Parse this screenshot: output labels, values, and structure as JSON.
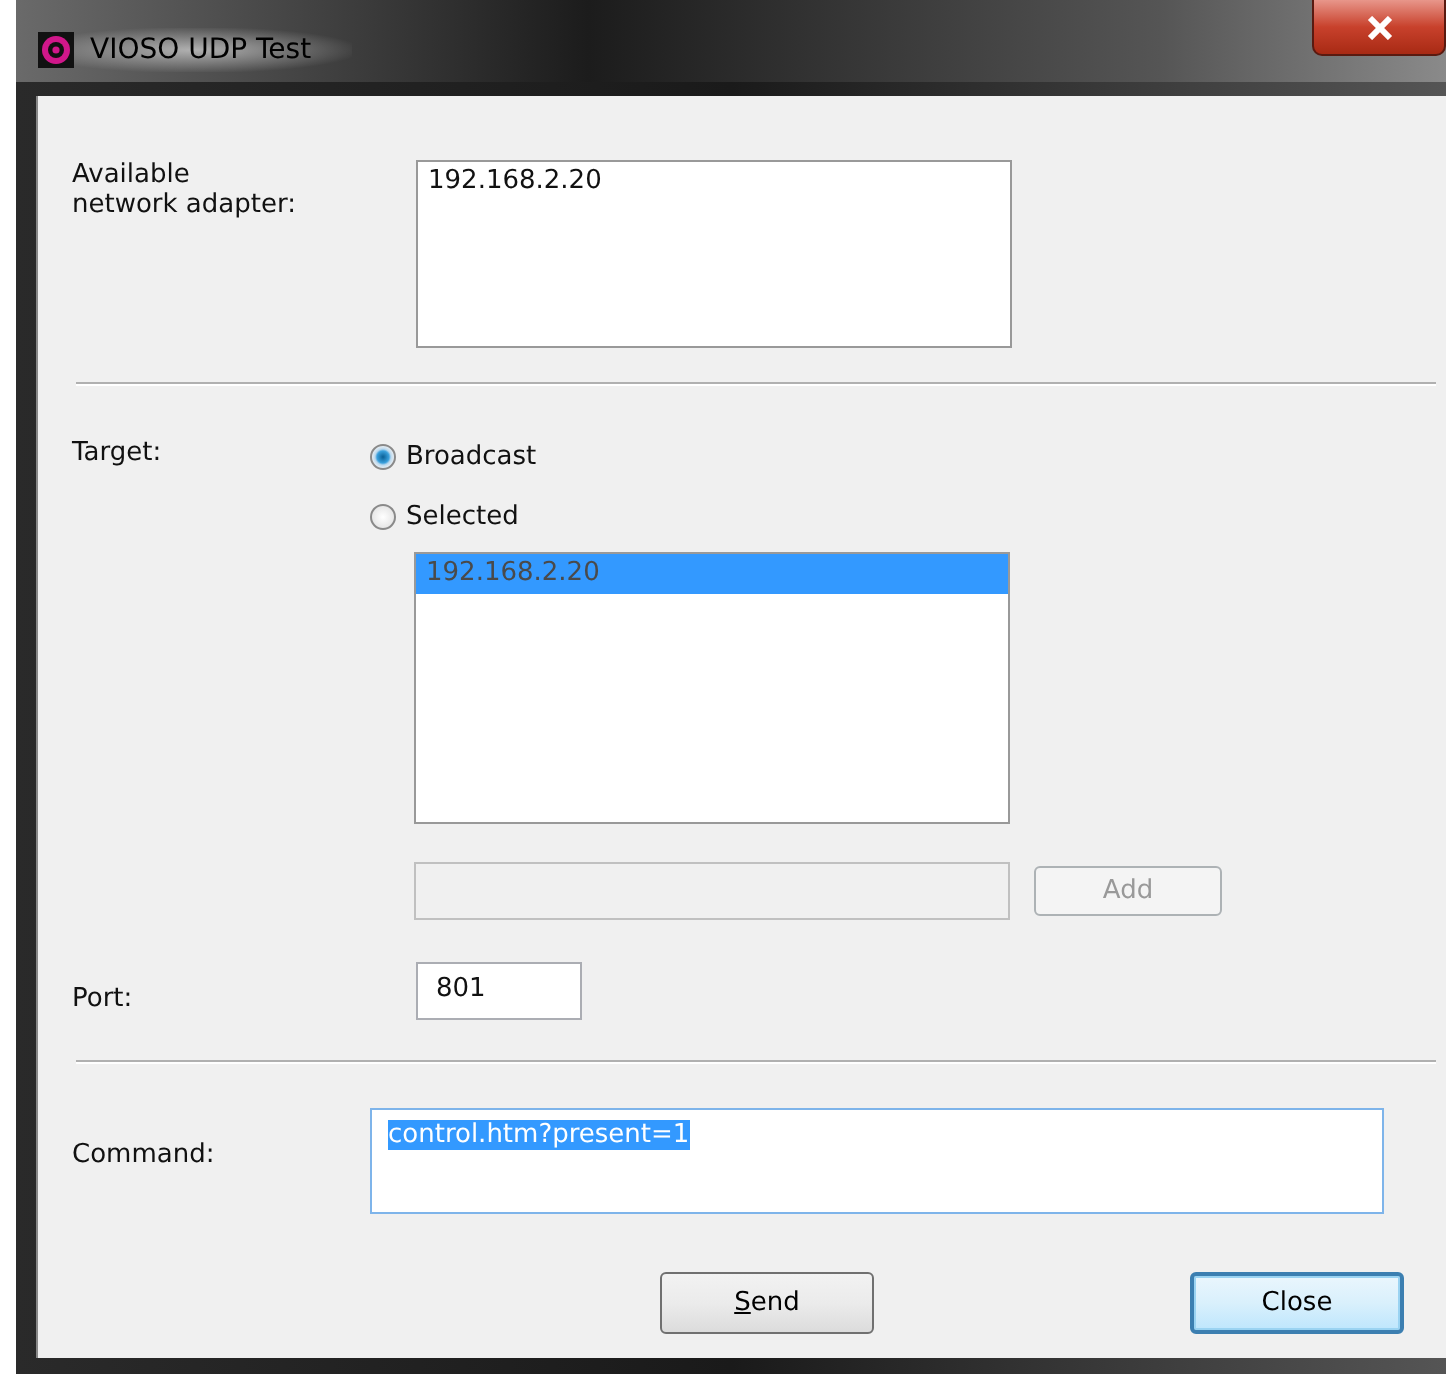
{
  "window": {
    "title": "VIOSO UDP Test"
  },
  "adapters": {
    "label": "Available\nnetwork adapter:",
    "items": [
      {
        "text": "192.168.2.20",
        "selected": false
      }
    ]
  },
  "target": {
    "label": "Target:",
    "options": [
      {
        "label": "Broadcast",
        "selected": true
      },
      {
        "label": "Selected",
        "selected": false
      }
    ],
    "list": {
      "disabled": true,
      "items": [
        {
          "text": "192.168.2.20",
          "selected": true
        }
      ]
    },
    "add_field": {
      "disabled": true
    },
    "add_button": {
      "label": "Add",
      "disabled": true
    }
  },
  "port": {
    "label": "Port:",
    "value": "801"
  },
  "command": {
    "label": "Command:",
    "value": "control.htm?present=1",
    "text_selected": true
  },
  "buttons": [
    {
      "label": "Send",
      "mnemonic_underlined": true,
      "default": false
    },
    {
      "label": "Close",
      "mnemonic_underlined": false,
      "default": true
    }
  ]
}
